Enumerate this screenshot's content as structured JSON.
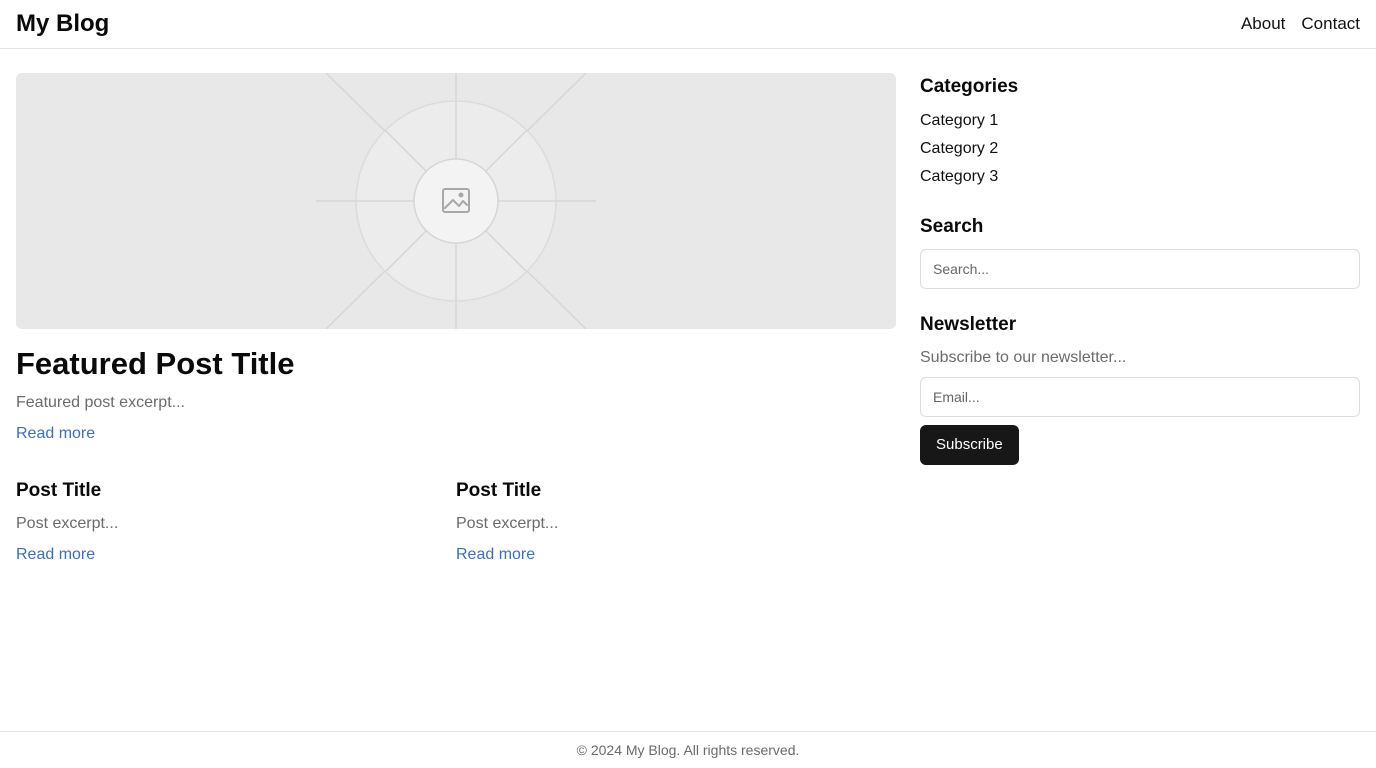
{
  "header": {
    "site_title": "My Blog",
    "nav": [
      {
        "label": "About"
      },
      {
        "label": "Contact"
      }
    ]
  },
  "featured": {
    "image_icon": "image-placeholder-icon",
    "title": "Featured Post Title",
    "excerpt": "Featured post excerpt...",
    "read_more": "Read more"
  },
  "posts": [
    {
      "title": "Post Title",
      "excerpt": "Post excerpt...",
      "read_more": "Read more"
    },
    {
      "title": "Post Title",
      "excerpt": "Post excerpt...",
      "read_more": "Read more"
    }
  ],
  "sidebar": {
    "categories": {
      "title": "Categories",
      "items": [
        "Category 1",
        "Category 2",
        "Category 3"
      ]
    },
    "search": {
      "title": "Search",
      "placeholder": "Search..."
    },
    "newsletter": {
      "title": "Newsletter",
      "description": "Subscribe to our newsletter...",
      "email_placeholder": "Email...",
      "button_label": "Subscribe"
    }
  },
  "footer": {
    "text": "© 2024 My Blog. All rights reserved."
  },
  "colors": {
    "link": "#3a6fc0",
    "button_bg": "#171717",
    "muted_text": "#6b6b6b",
    "placeholder_bg": "#e8e8e8"
  }
}
